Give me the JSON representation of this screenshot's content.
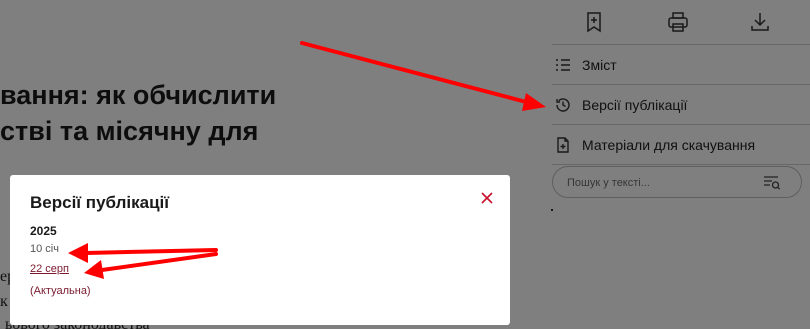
{
  "article": {
    "heading_line1": "вання: як обчислити",
    "heading_line2": "стві та місячну для",
    "body_fragments": [
      "ер",
      "к і",
      "ьового законодавства"
    ]
  },
  "toolbar": {
    "icons": [
      "bookmark-add-icon",
      "print-icon",
      "download-icon"
    ]
  },
  "sidebar": {
    "items": [
      {
        "label": "Зміст",
        "icon": "list-icon"
      },
      {
        "label": "Версії публікації",
        "icon": "history-icon"
      },
      {
        "label": "Матеріали для скачування",
        "icon": "file-add-icon"
      }
    ],
    "search": {
      "placeholder": "Пошук у тексті...",
      "value": ""
    }
  },
  "modal": {
    "title": "Версії публікації",
    "year": "2025",
    "versions": [
      {
        "date": "10 січ"
      },
      {
        "date": "22 серп",
        "note": "(Актуальна)"
      }
    ]
  },
  "colors": {
    "overlay": "rgba(0,0,0,0.5)",
    "accent": "#c8102e",
    "link": "#7a1a2e",
    "annotation_arrow": "#ff0000"
  }
}
